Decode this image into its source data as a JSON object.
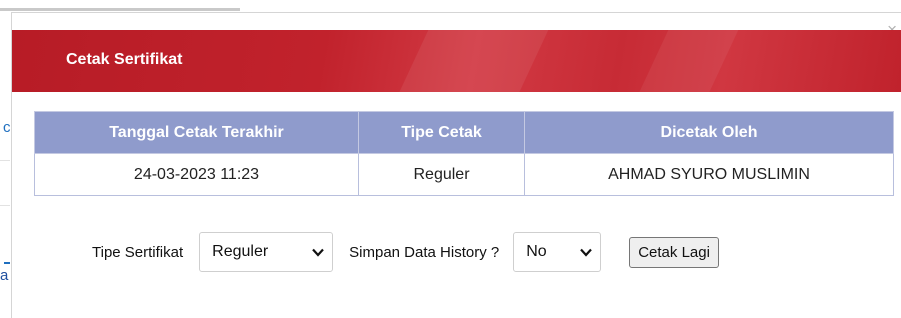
{
  "background": {
    "fragment_top": "c",
    "fragment_bottom": "a"
  },
  "modal": {
    "title": "Cetak Sertifikat",
    "close_label": "×",
    "table": {
      "headers": [
        "Tanggal Cetak Terakhir",
        "Tipe Cetak",
        "Dicetak Oleh"
      ],
      "rows": [
        [
          "24-03-2023 11:23",
          "Reguler",
          "AHMAD SYURO MUSLIMIN"
        ]
      ]
    },
    "form": {
      "tipe_label": "Tipe Sertifikat",
      "tipe_value": "Reguler",
      "simpan_label": "Simpan Data History ?",
      "simpan_value": "No",
      "print_button": "Cetak Lagi"
    }
  },
  "colors": {
    "header_red": "#c1222c",
    "table_header": "#8f9bcc"
  },
  "icons": {
    "close": "close-icon",
    "select_arrow": "chevron-down-icon"
  }
}
